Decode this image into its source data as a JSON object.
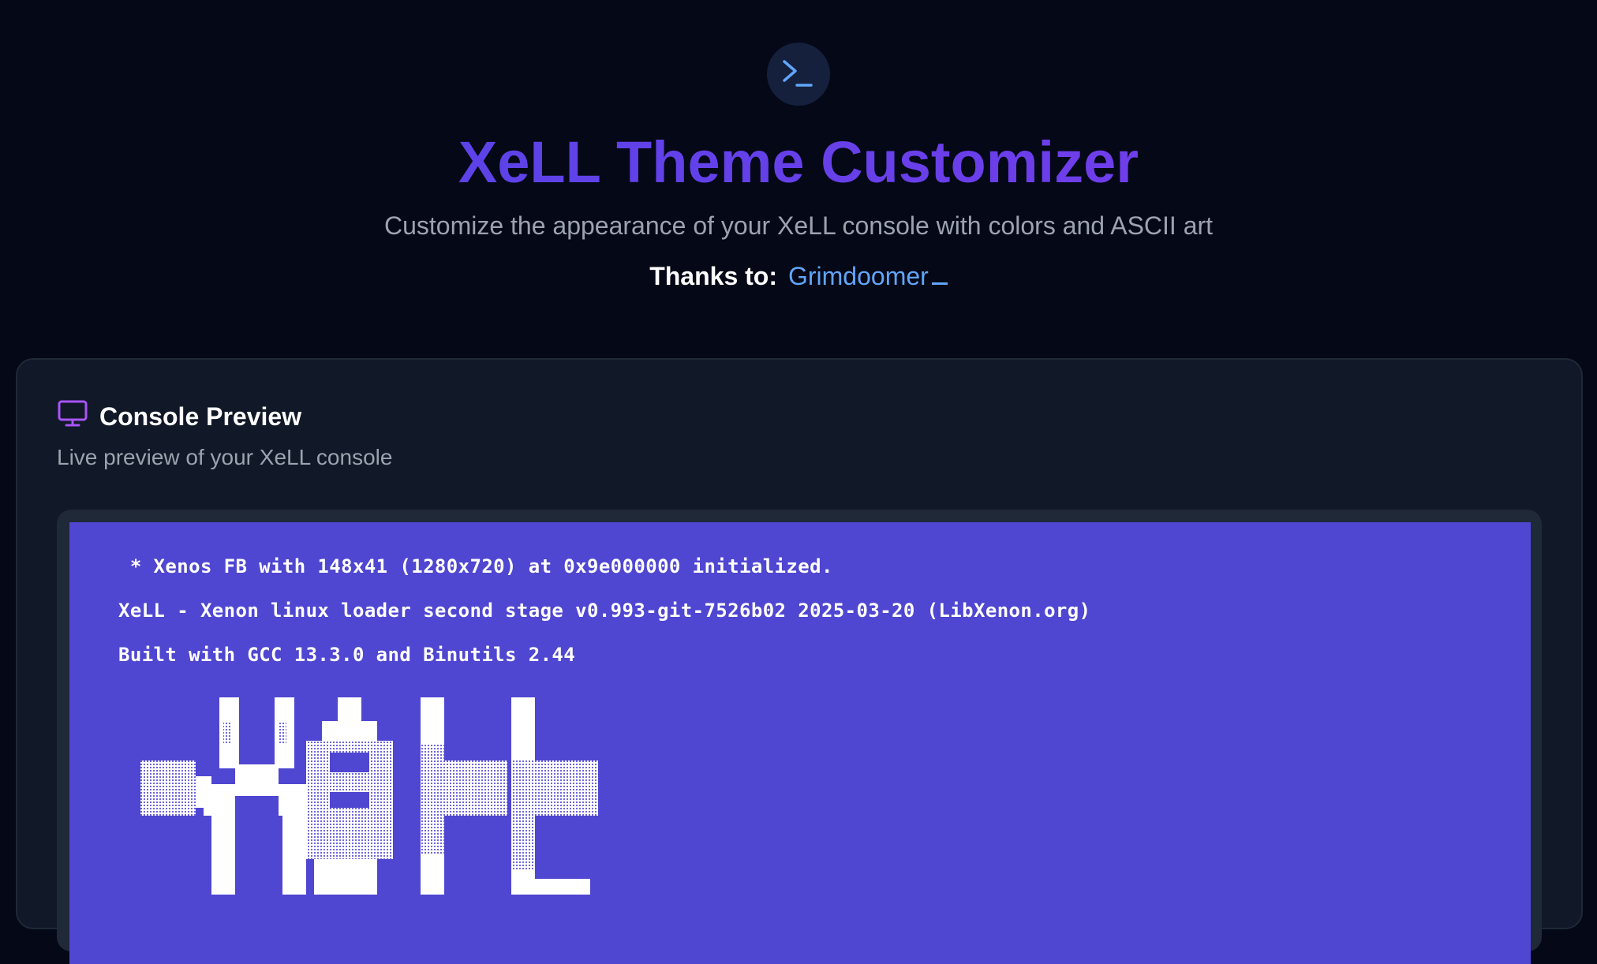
{
  "hero": {
    "icon": "terminal-icon",
    "title": "XeLL Theme Customizer",
    "subtitle": "Customize the appearance of your XeLL console with colors and ASCII art",
    "thanks_label": "Thanks to:",
    "thanks_name": "Grimdoomer"
  },
  "preview_card": {
    "icon": "monitor-icon",
    "title": "Console Preview",
    "subtitle": "Live preview of your XeLL console",
    "console": {
      "background_color": "#4f46d1",
      "text_color": "#ffffff",
      "lines": [
        " * Xenos FB with 148x41 (1280x720) at 0x9e000000 initialized.",
        "XeLL - Xenon linux loader second stage v0.993-git-7526b02 2025-03-20 (LibXenon.org)",
        "Built with GCC 13.3.0 and Binutils 2.44"
      ]
    }
  },
  "colors": {
    "page_background": "#050816",
    "accent_start": "#4f46e5",
    "accent_end": "#7c3aed",
    "link": "#60a5fa"
  }
}
